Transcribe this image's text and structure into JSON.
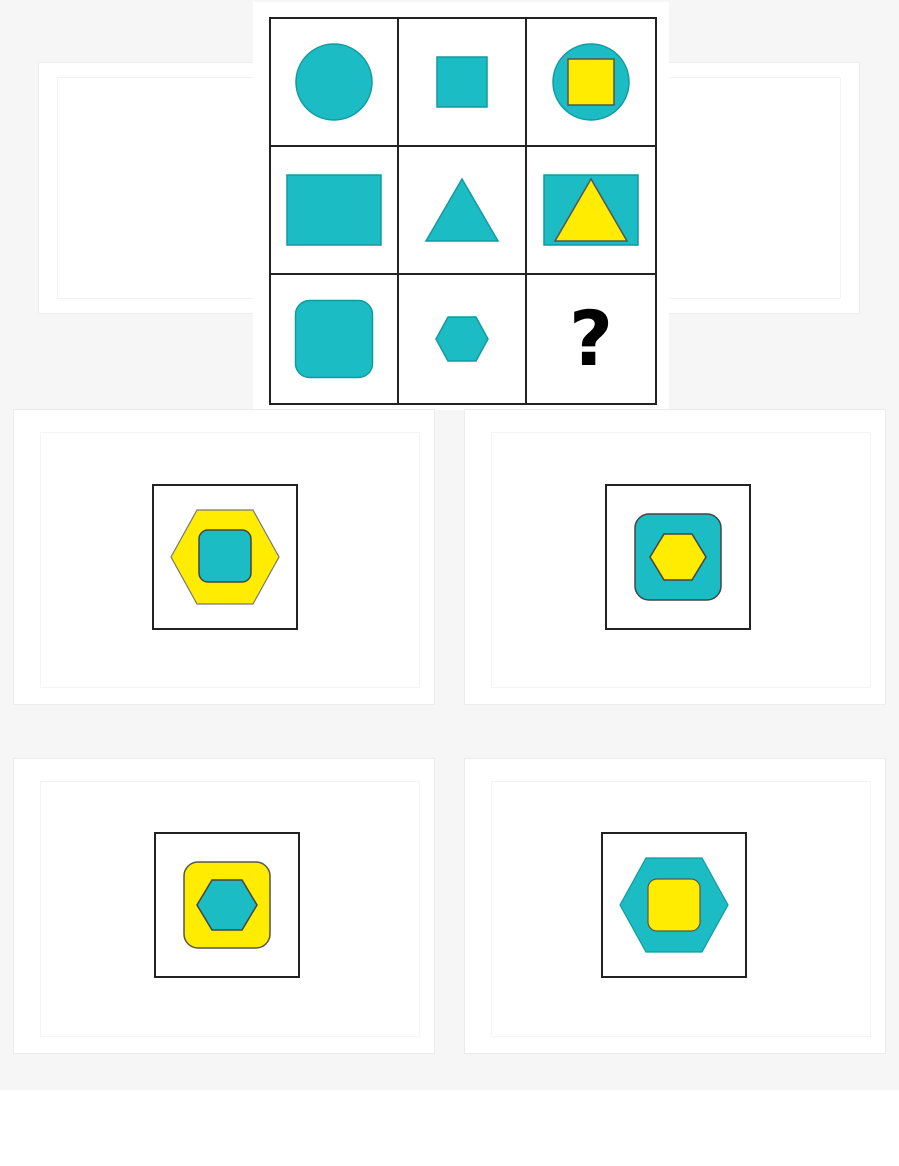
{
  "puzzle": {
    "question_mark": "?",
    "colors": {
      "teal": "#1bbcc4",
      "yellow": "#ffec00",
      "grid_line": "#222222"
    },
    "cells": [
      [
        "circle",
        "square",
        "circle-with-square"
      ],
      [
        "rectangle",
        "triangle",
        "rectangle-with-triangle"
      ],
      [
        "rounded-square",
        "hexagon",
        "unknown"
      ]
    ]
  },
  "options": [
    {
      "outer": "yellow-hexagon",
      "inner": "teal-rounded-square"
    },
    {
      "outer": "teal-rounded-square",
      "inner": "yellow-hexagon"
    },
    {
      "outer": "yellow-rounded-square",
      "inner": "teal-hexagon"
    },
    {
      "outer": "teal-hexagon",
      "inner": "yellow-rounded-square"
    }
  ]
}
